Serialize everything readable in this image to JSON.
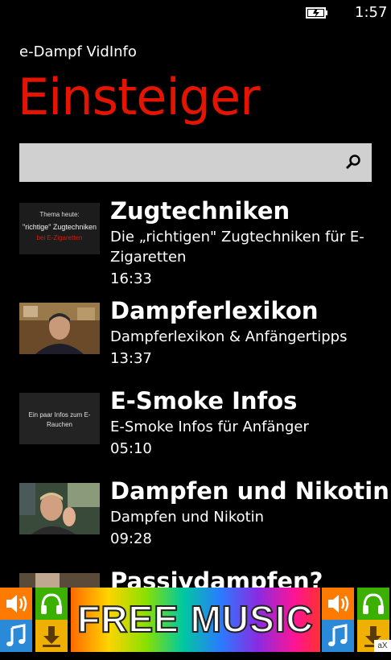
{
  "status_bar": {
    "time": "1:57",
    "battery_icon": "battery-charging-icon"
  },
  "app": {
    "title": "e-Dampf VidInfo",
    "page_title": "Einsteiger",
    "accent": "#e51400"
  },
  "search": {
    "value": "",
    "placeholder": "",
    "icon": "search-icon"
  },
  "videos": [
    {
      "title": "Zugtechniken",
      "description": "Die „richtigen\" Zugtechniken für E-Zigaretten",
      "duration": "16:33",
      "thumb_text": [
        "Thema heute:",
        "\"richtige\" Zugtechniken",
        "bei E-Zigaretten"
      ]
    },
    {
      "title": "Dampferlexikon",
      "description": "Dampferlexikon & Anfängertipps",
      "duration": "13:37"
    },
    {
      "title": "E-Smoke Infos",
      "description": "E-Smoke Infos für Anfänger",
      "duration": "05:10",
      "thumb_text": [
        "Ein paar Infos zum E-",
        "Rauchen"
      ]
    },
    {
      "title": "Dampfen und Nikotin",
      "description": "Dampfen und Nikotin",
      "duration": "09:28"
    },
    {
      "title": "Passivdampfen?",
      "description": "",
      "duration": ""
    }
  ],
  "ad": {
    "text": "FREE MUSIC",
    "mark": "aX",
    "icons": [
      "speaker-icon",
      "headphones-icon",
      "music-note-icon",
      "download-icon"
    ]
  }
}
